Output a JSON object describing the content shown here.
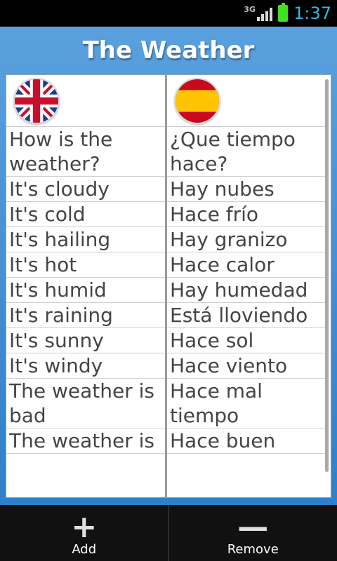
{
  "status_bar": {
    "network": "3G",
    "time": "1:37"
  },
  "app": {
    "title": "The Weather"
  },
  "columns": {
    "english": {
      "flag_icon": "uk-flag-icon",
      "rows": [
        "How is the weather?",
        "It's cloudy",
        "It's cold",
        "It's hailing",
        "It's hot",
        "It's humid",
        "It's raining",
        "It's sunny",
        "It's windy",
        "The weather is bad",
        "The weather is"
      ]
    },
    "spanish": {
      "flag_icon": "spain-flag-icon",
      "rows": [
        "¿Que tiempo hace?",
        "Hay nubes",
        "Hace frío",
        "Hay granizo",
        "Hace calor",
        "Hay humedad",
        "Está lloviendo",
        "Hace sol",
        "Hace viento",
        "Hace mal tiempo",
        "Hace buen"
      ]
    }
  },
  "bottom_bar": {
    "add": {
      "icon": "plus-icon",
      "label": "Add"
    },
    "remove": {
      "icon": "minus-icon",
      "label": "Remove"
    }
  }
}
